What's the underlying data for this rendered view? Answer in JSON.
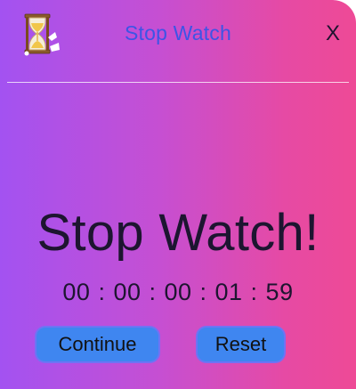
{
  "window": {
    "title": "Stop Watch",
    "close_label": "X"
  },
  "main": {
    "heading": "Stop Watch!",
    "timer_display": "00 : 00 : 00 : 01 : 59"
  },
  "controls": {
    "continue_label": "Continue",
    "reset_label": "Reset"
  },
  "icons": {
    "app_icon": "hourglass-icon"
  },
  "colors": {
    "gradient_start": "#a352f1",
    "gradient_end": "#ee4a96",
    "title": "#3d54e6",
    "button": "#3f86f0",
    "button_border": "#6f73f4"
  }
}
